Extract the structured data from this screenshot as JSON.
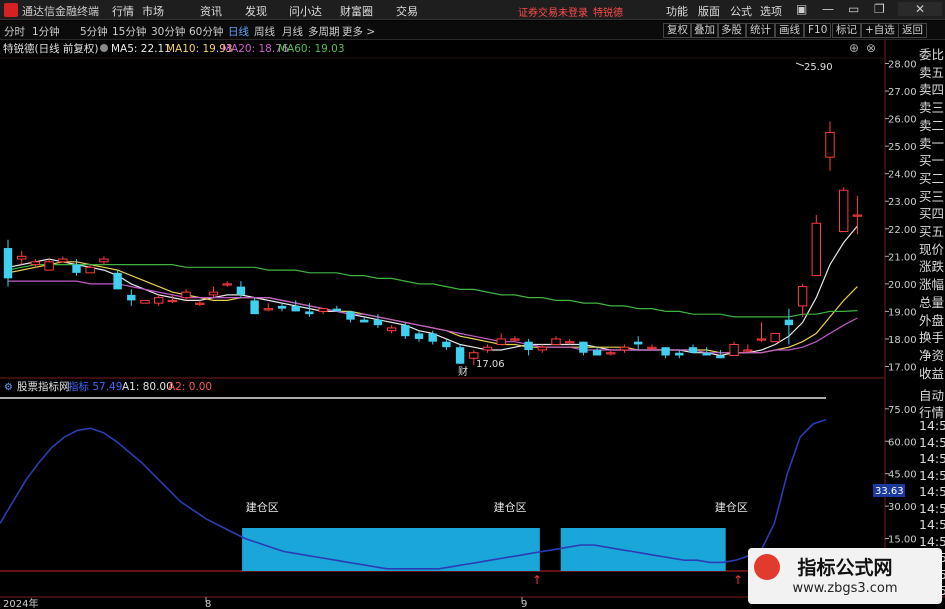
{
  "app": {
    "title": "通达信金融终端",
    "warning": "证券交易未登录",
    "stock_name_top": "特锐德"
  },
  "menu": [
    "行情",
    "市场",
    "资讯",
    "发现",
    "问小达",
    "财富圈",
    "交易"
  ],
  "toolbar": [
    "功能",
    "版面",
    "公式",
    "选项"
  ],
  "periods": [
    "分时",
    "1分钟",
    "5分钟",
    "15分钟",
    "30分钟",
    "60分钟",
    "日线",
    "周线",
    "月线",
    "多周期",
    "更多 >"
  ],
  "active_period": "日线",
  "right_buttons": [
    "复权",
    "叠加",
    "多股",
    "统计",
    "画线",
    "F10",
    "标记",
    "+自选",
    "返回"
  ],
  "main": {
    "title": "特锐德(日线 前复权)",
    "ma": [
      {
        "label": "MA5: 22.11",
        "color": "#e8e8e8"
      },
      {
        "label": "MA10: 19.93",
        "color": "#f0d35a"
      },
      {
        "label": "MA20: 18.76",
        "color": "#d062d0"
      },
      {
        "label": "MA60: 19.03",
        "color": "#50c050"
      }
    ],
    "high_label": "25.90",
    "low_label": "17.06",
    "cai_label": "财"
  },
  "chart_data": {
    "type": "candlestick",
    "y_axis": {
      "ticks": [
        "28.00",
        "27.00",
        "26.00",
        "25.00",
        "24.00",
        "23.00",
        "22.00",
        "21.00",
        "20.00",
        "19.00",
        "18.00",
        "17.00"
      ],
      "range": [
        16.8,
        28.2
      ]
    },
    "candles": [
      [
        21.3,
        21.6,
        19.9,
        20.2
      ],
      [
        20.9,
        21.2,
        20.7,
        21.0
      ],
      [
        20.7,
        20.9,
        20.6,
        20.8
      ],
      [
        20.5,
        20.9,
        20.5,
        20.8
      ],
      [
        20.8,
        21.0,
        20.8,
        20.9
      ],
      [
        20.7,
        20.9,
        20.3,
        20.4
      ],
      [
        20.4,
        20.7,
        20.4,
        20.6
      ],
      [
        20.8,
        21.0,
        20.7,
        20.9
      ],
      [
        20.4,
        20.5,
        19.8,
        19.8
      ],
      [
        19.6,
        19.8,
        19.2,
        19.4
      ],
      [
        19.3,
        19.4,
        19.3,
        19.4
      ],
      [
        19.3,
        19.6,
        19.2,
        19.5
      ],
      [
        19.4,
        19.6,
        19.3,
        19.4
      ],
      [
        19.5,
        19.8,
        19.4,
        19.7
      ],
      [
        19.3,
        19.4,
        19.2,
        19.3
      ],
      [
        19.6,
        19.9,
        19.5,
        19.7
      ],
      [
        20.0,
        20.1,
        19.9,
        20.0
      ],
      [
        19.9,
        20.1,
        19.5,
        19.6
      ],
      [
        19.4,
        19.5,
        18.9,
        18.9
      ],
      [
        19.1,
        19.3,
        19.0,
        19.1
      ],
      [
        19.2,
        19.3,
        19.0,
        19.1
      ],
      [
        19.2,
        19.4,
        19.0,
        19.0
      ],
      [
        19.0,
        19.3,
        18.8,
        18.9
      ],
      [
        19.0,
        19.1,
        18.9,
        19.1
      ],
      [
        19.1,
        19.2,
        19.0,
        19.0
      ],
      [
        19.0,
        19.0,
        18.6,
        18.7
      ],
      [
        18.7,
        18.8,
        18.6,
        18.6
      ],
      [
        18.7,
        18.9,
        18.4,
        18.5
      ],
      [
        18.3,
        18.5,
        18.2,
        18.4
      ],
      [
        18.5,
        18.6,
        18.0,
        18.1
      ],
      [
        18.2,
        18.3,
        17.9,
        18.0
      ],
      [
        18.2,
        18.3,
        17.8,
        17.9
      ],
      [
        17.9,
        18.0,
        17.6,
        17.7
      ],
      [
        17.7,
        17.8,
        17.1,
        17.1
      ],
      [
        17.3,
        17.6,
        17.06,
        17.5
      ],
      [
        17.6,
        17.8,
        17.5,
        17.7
      ],
      [
        17.8,
        18.2,
        17.8,
        18.0
      ],
      [
        18.0,
        18.1,
        17.9,
        18.0
      ],
      [
        17.9,
        18.0,
        17.4,
        17.6
      ],
      [
        17.6,
        17.8,
        17.5,
        17.7
      ],
      [
        17.8,
        18.1,
        17.8,
        18.0
      ],
      [
        17.9,
        18.0,
        17.8,
        17.9
      ],
      [
        17.9,
        17.9,
        17.4,
        17.5
      ],
      [
        17.6,
        17.7,
        17.4,
        17.4
      ],
      [
        17.5,
        17.6,
        17.4,
        17.5
      ],
      [
        17.6,
        17.8,
        17.5,
        17.7
      ],
      [
        17.9,
        18.1,
        17.6,
        17.8
      ],
      [
        17.7,
        17.8,
        17.6,
        17.7
      ],
      [
        17.7,
        17.7,
        17.3,
        17.4
      ],
      [
        17.5,
        17.6,
        17.3,
        17.4
      ],
      [
        17.7,
        17.8,
        17.5,
        17.5
      ],
      [
        17.5,
        17.7,
        17.4,
        17.4
      ],
      [
        17.4,
        17.6,
        17.3,
        17.3
      ],
      [
        17.4,
        17.9,
        17.4,
        17.8
      ],
      [
        17.6,
        17.8,
        17.5,
        17.6
      ],
      [
        18.0,
        18.6,
        17.9,
        18.0
      ],
      [
        17.9,
        18.2,
        17.9,
        18.2
      ],
      [
        18.7,
        19.1,
        17.8,
        18.5
      ],
      [
        19.2,
        20.0,
        18.8,
        19.9
      ],
      [
        20.3,
        22.5,
        20.3,
        22.2
      ],
      [
        24.6,
        25.9,
        24.1,
        25.5
      ],
      [
        21.9,
        23.5,
        21.9,
        23.4
      ],
      [
        22.5,
        23.2,
        21.8,
        22.5
      ]
    ],
    "ma_series": [
      {
        "name": "MA5",
        "color": "#e6e6e6",
        "values": [
          20.6,
          20.7,
          20.8,
          20.9,
          20.8,
          20.7,
          20.6,
          20.5,
          20.3,
          20.0,
          19.8,
          19.6,
          19.5,
          19.4,
          19.4,
          19.5,
          19.6,
          19.6,
          19.5,
          19.4,
          19.3,
          19.2,
          19.1,
          19.0,
          19.0,
          18.9,
          18.8,
          18.7,
          18.6,
          18.5,
          18.3,
          18.2,
          18.0,
          17.8,
          17.7,
          17.6,
          17.6,
          17.7,
          17.8,
          17.8,
          17.8,
          17.8,
          17.8,
          17.7,
          17.6,
          17.6,
          17.6,
          17.6,
          17.6,
          17.6,
          17.5,
          17.5,
          17.4,
          17.5,
          17.5,
          17.6,
          17.8,
          18.1,
          18.6,
          19.5,
          20.7,
          21.5,
          22.1
        ]
      },
      {
        "name": "MA10",
        "color": "#e8cf52",
        "values": [
          20.4,
          20.5,
          20.6,
          20.7,
          20.8,
          20.8,
          20.7,
          20.6,
          20.5,
          20.3,
          20.1,
          19.9,
          19.7,
          19.6,
          19.5,
          19.4,
          19.4,
          19.5,
          19.5,
          19.5,
          19.4,
          19.3,
          19.2,
          19.1,
          19.0,
          19.0,
          18.9,
          18.8,
          18.7,
          18.6,
          18.5,
          18.4,
          18.3,
          18.1,
          18.0,
          17.9,
          17.8,
          17.8,
          17.7,
          17.7,
          17.7,
          17.7,
          17.7,
          17.7,
          17.7,
          17.7,
          17.6,
          17.6,
          17.6,
          17.6,
          17.6,
          17.6,
          17.5,
          17.5,
          17.5,
          17.5,
          17.6,
          17.7,
          17.9,
          18.2,
          18.8,
          19.4,
          19.9
        ]
      },
      {
        "name": "MA20",
        "color": "#c05ac8",
        "values": [
          20.1,
          20.1,
          20.1,
          20.1,
          20.1,
          20.1,
          20.0,
          20.0,
          20.0,
          19.9,
          19.8,
          19.7,
          19.6,
          19.5,
          19.5,
          19.5,
          19.5,
          19.5,
          19.5,
          19.5,
          19.4,
          19.3,
          19.2,
          19.1,
          19.0,
          18.9,
          18.9,
          18.8,
          18.7,
          18.6,
          18.5,
          18.4,
          18.3,
          18.2,
          18.1,
          18.0,
          17.9,
          17.9,
          17.8,
          17.7,
          17.7,
          17.7,
          17.6,
          17.6,
          17.6,
          17.6,
          17.6,
          17.6,
          17.6,
          17.6,
          17.6,
          17.5,
          17.5,
          17.5,
          17.5,
          17.5,
          17.6,
          17.6,
          17.7,
          17.9,
          18.2,
          18.5,
          18.76
        ]
      },
      {
        "name": "MA60",
        "color": "#3fb33f",
        "values": [
          20.5,
          20.6,
          20.7,
          20.7,
          20.7,
          20.7,
          20.7,
          20.7,
          20.7,
          20.7,
          20.7,
          20.7,
          20.7,
          20.6,
          20.6,
          20.6,
          20.6,
          20.6,
          20.6,
          20.5,
          20.5,
          20.5,
          20.4,
          20.4,
          20.4,
          20.3,
          20.3,
          20.2,
          20.2,
          20.1,
          20.0,
          20.0,
          19.9,
          19.8,
          19.8,
          19.7,
          19.6,
          19.6,
          19.5,
          19.5,
          19.4,
          19.4,
          19.3,
          19.3,
          19.2,
          19.2,
          19.1,
          19.1,
          19.0,
          19.0,
          18.9,
          18.9,
          18.9,
          18.8,
          18.8,
          18.8,
          18.8,
          18.8,
          18.9,
          18.9,
          19.0,
          19.0,
          19.03
        ]
      }
    ]
  },
  "indicator": {
    "title": "股票指标网",
    "line1_label": "指标 57.49",
    "a1_label": "A1: 80.00",
    "a2_label": "A2: 0.00",
    "y_ticks": [
      "75.00",
      "60.00",
      "45.00",
      "33.63",
      "30.00",
      "15.00"
    ],
    "current_value": "33.63",
    "jcq_label": "建仓区",
    "zones": [
      {
        "label": "建仓区",
        "from": 0.26,
        "to": 0.61
      },
      {
        "label": "建仓区",
        "from": 0.62,
        "to": 0.82
      }
    ],
    "zone_labels_at": [
      0.28,
      0.56,
      0.81
    ],
    "line_values": [
      22,
      32,
      42,
      50,
      57,
      62,
      65,
      66,
      64,
      60,
      55,
      50,
      44,
      38,
      32,
      28,
      24,
      21,
      18,
      15,
      13,
      11,
      9,
      8,
      7,
      6,
      5,
      4,
      3,
      2,
      1,
      1,
      1,
      1,
      1,
      2,
      3,
      4,
      5,
      6,
      7,
      8,
      9,
      10,
      11,
      12,
      12,
      11,
      10,
      9,
      8,
      7,
      6,
      5,
      5,
      4,
      4,
      5,
      7,
      10,
      22,
      45,
      62,
      68,
      70
    ]
  },
  "x_axis": {
    "labels": [
      "2024年",
      "8",
      "9"
    ]
  },
  "side_panel": [
    "委比",
    "卖五",
    "卖四",
    "卖三",
    "卖二",
    "卖一",
    "买一",
    "买二",
    "买三",
    "买四",
    "买五",
    "现价",
    "涨跌",
    "涨幅",
    "总量",
    "外盘",
    "换手",
    "净资",
    "收益"
  ],
  "side_panel_lower": [
    "自动",
    "行情",
    "14:5",
    "14:5",
    "14:5",
    "14:5",
    "14:5",
    "14:5",
    "14:5",
    "14:5",
    "14:5",
    "14:5",
    "14:5"
  ],
  "watermark": {
    "title": "指标公式网",
    "url": "www.zbgs3.com"
  }
}
